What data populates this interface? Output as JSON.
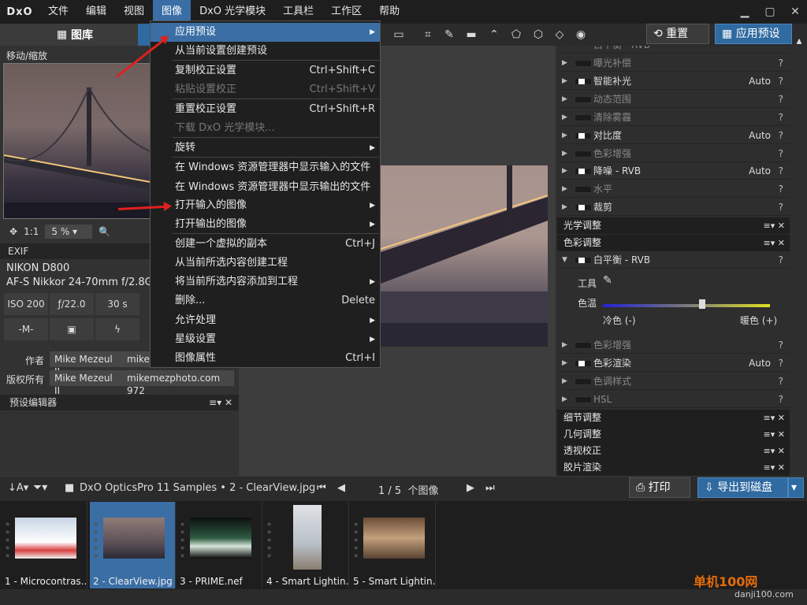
{
  "menubar": {
    "logo": "DxO",
    "items": [
      "文件",
      "编辑",
      "视图",
      "图像",
      "DxO 光学模块",
      "工具栏",
      "工作区",
      "帮助"
    ]
  },
  "left": {
    "library_tab": "图库",
    "move_zoom": "移动/缩放",
    "zoom_fit": "1:1",
    "zoom_value": "5 %",
    "exif_title": "EXIF",
    "camera": "NIKON D800",
    "lens": "AF-S Nikkor 24-70mm f/2.8G E",
    "iso": "ISO 200",
    "aperture": "ƒ/22.0",
    "shutter": "30 s",
    "mode": "-M-",
    "author_label": "作者",
    "author_value": "Mike Mezeul II",
    "author_value2": "miker",
    "copyright_label": "版权所有",
    "copyright_value": "Mike Mezeul II",
    "copyright_value2": "mikemezphoto.com 972",
    "preset_editor": "预设编辑器"
  },
  "context_menu": {
    "items": [
      {
        "label": "应用预设",
        "shortcut": "",
        "sub": true,
        "disabled": false
      },
      {
        "label": "从当前设置创建预设",
        "shortcut": "",
        "sub": false,
        "disabled": false
      },
      {
        "label": "复制校正设置",
        "shortcut": "Ctrl+Shift+C",
        "sub": false,
        "disabled": false
      },
      {
        "label": "粘贴设置校正",
        "shortcut": "Ctrl+Shift+V",
        "sub": false,
        "disabled": true
      },
      {
        "label": "重置校正设置",
        "shortcut": "Ctrl+Shift+R",
        "sub": false,
        "disabled": false
      },
      {
        "label": "下载 DxO 光学模块...",
        "shortcut": "",
        "sub": false,
        "disabled": true
      },
      {
        "label": "旋转",
        "shortcut": "",
        "sub": true,
        "disabled": false
      },
      {
        "label": "在 Windows 资源管理器中显示输入的文件",
        "shortcut": "",
        "sub": false,
        "disabled": false
      },
      {
        "label": "在 Windows 资源管理器中显示输出的文件",
        "shortcut": "",
        "sub": false,
        "disabled": false
      },
      {
        "label": "打开输入的图像",
        "shortcut": "",
        "sub": true,
        "disabled": false
      },
      {
        "label": "打开输出的图像",
        "shortcut": "",
        "sub": true,
        "disabled": false
      },
      {
        "label": "创建一个虚拟的副本",
        "shortcut": "Ctrl+J",
        "sub": false,
        "disabled": false
      },
      {
        "label": "从当前所选内容创建工程",
        "shortcut": "",
        "sub": false,
        "disabled": false
      },
      {
        "label": "将当前所选内容添加到工程",
        "shortcut": "",
        "sub": true,
        "disabled": false
      },
      {
        "label": "删除...",
        "shortcut": "Delete",
        "sub": false,
        "disabled": false
      },
      {
        "label": "允许处理",
        "shortcut": "",
        "sub": true,
        "disabled": false
      },
      {
        "label": "星级设置",
        "shortcut": "",
        "sub": true,
        "disabled": false
      },
      {
        "label": "图像属性",
        "shortcut": "Ctrl+I",
        "sub": false,
        "disabled": false
      }
    ]
  },
  "toolbar": {
    "reset": "重置",
    "apply_preset": "应用预设"
  },
  "right": {
    "rows_top": [
      {
        "label": "曝光补偿",
        "auto": "",
        "on": false
      },
      {
        "label": "智能补光",
        "auto": "Auto",
        "on": true
      },
      {
        "label": "动态范围",
        "auto": "",
        "on": false
      },
      {
        "label": "清除雾霾",
        "auto": "",
        "on": false
      },
      {
        "label": "对比度",
        "auto": "Auto",
        "on": true
      },
      {
        "label": "色彩增强",
        "auto": "",
        "on": false
      },
      {
        "label": "降噪 - RVB",
        "auto": "Auto",
        "on": true
      },
      {
        "label": "水平",
        "auto": "",
        "on": false
      },
      {
        "label": "裁剪",
        "auto": "",
        "on": true
      }
    ],
    "top_partial": "白平衡 - RVB",
    "section_optical": "光学调整",
    "section_color": "色彩调整",
    "wb_label": "白平衡 - RVB",
    "tool_label": "工具",
    "temp_label": "色温",
    "cold": "冷色 (-)",
    "warm": "暖色 (+)",
    "rows_color": [
      {
        "label": "色彩增强",
        "auto": "",
        "on": false
      },
      {
        "label": "色彩渲染",
        "auto": "Auto",
        "on": true
      },
      {
        "label": "色调样式",
        "auto": "",
        "on": false
      },
      {
        "label": "HSL",
        "auto": "",
        "on": false
      }
    ],
    "sections_bottom": [
      "细节调整",
      "几何调整",
      "透视校正",
      "胶片渲染"
    ]
  },
  "bottom": {
    "folder": "DxO OpticsPro 11 Samples",
    "file": "2 - ClearView.jpg",
    "page": "1 / 5",
    "count_label": "个图像",
    "print": "打印",
    "export": "导出到磁盘"
  },
  "thumbs": [
    "1 - Microcontras...",
    "2 - ClearView.jpg",
    "3 - PRIME.nef",
    "4 - Smart Lightin...",
    "5 - Smart Lightin..."
  ],
  "watermark": {
    "name": "单机100网",
    "url": "danji100.com"
  }
}
